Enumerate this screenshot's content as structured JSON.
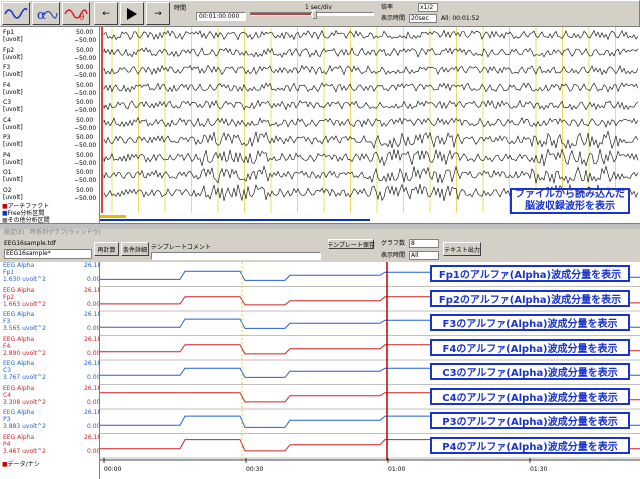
{
  "toolbar": {
    "time_label": "時間",
    "time_value": "00:01:00.000",
    "scale_label": "1 sec/div",
    "rate_label": "倍率",
    "rate_value": "x1/2",
    "display_time_label": "表示時間",
    "display_time_value": "20sec",
    "all_label": "All: 00:01:52"
  },
  "eeg": {
    "channels": [
      {
        "name": "Fp1",
        "unit": "[uvolt]",
        "max": "50.00",
        "min": "−50.00"
      },
      {
        "name": "Fp2",
        "unit": "[uvolt]",
        "max": "50.00",
        "min": "−50.00"
      },
      {
        "name": "F3",
        "unit": "[uvolt]",
        "max": "50.00",
        "min": "−50.00"
      },
      {
        "name": "F4",
        "unit": "[uvolt]",
        "max": "50.00",
        "min": "−50.00"
      },
      {
        "name": "C3",
        "unit": "[uvolt]",
        "max": "50.00",
        "min": "−50.00"
      },
      {
        "name": "C4",
        "unit": "[uvolt]",
        "max": "50.00",
        "min": "−50.00"
      },
      {
        "name": "P3",
        "unit": "[uvolt]",
        "max": "50.00",
        "min": "−50.00"
      },
      {
        "name": "P4",
        "unit": "[uvolt]",
        "max": "50.00",
        "min": "−50.00"
      },
      {
        "name": "O1",
        "unit": "[uvolt]",
        "max": "50.00",
        "min": "−50.00"
      },
      {
        "name": "O2",
        "unit": "[uvolt]",
        "max": "50.00",
        "min": "−50.00"
      }
    ],
    "legend": [
      "アーチファクト",
      "Free分析区間",
      "その他分析区間"
    ],
    "legend_colors": [
      "#d00000",
      "#1030c0",
      "#808080"
    ],
    "callout_line1": "ファイルから読み込んだ",
    "callout_line2": "脳波収録波形を表示"
  },
  "tabs": [
    "設定(E)",
    "時系列グラフ(ウィンドウ)"
  ],
  "analysis": {
    "file_label": "EEG16sample.tdf",
    "file_select": "EEG16sample*",
    "buttons": [
      "再計算",
      "条件詳細",
      "テンプレートコメント"
    ],
    "template_save": "テンプレート保存",
    "graph_count_label": "グラフ数",
    "graph_count": "8",
    "display_time_label": "表示時間",
    "display_time_value": "All",
    "text_output": "テキスト出力",
    "rows": [
      {
        "title": "EEG Alpha",
        "ch": "Fp1",
        "max": "26.18",
        "value": "1.630 uvolt^2",
        "zero": "0.00",
        "color": "#2060d0",
        "callout": "Fp1のアルファ(Alpha)波成分量を表示",
        "levels": [
          0.25,
          0.25,
          0.65,
          0.65,
          0.2,
          0.2,
          0.45,
          0.45,
          0.6,
          0.6,
          0.2,
          0.2,
          0.35,
          0.35
        ]
      },
      {
        "title": "EEG Alpha",
        "ch": "Fp2",
        "max": "26.18",
        "value": "1.663 uvolt^2",
        "zero": "0.00",
        "color": "#d02020",
        "callout": "Fp2のアルファ(Alpha)波成分量を表示",
        "levels": [
          0.25,
          0.25,
          0.6,
          0.6,
          0.2,
          0.2,
          0.4,
          0.4,
          0.6,
          0.6,
          0.2,
          0.2,
          0.3,
          0.3
        ]
      },
      {
        "title": "EEG Alpha",
        "ch": "F3",
        "max": "26.18",
        "value": "3.565 uvolt^2",
        "zero": "0.00",
        "color": "#2060d0",
        "callout": "F3のアルファ(Alpha)波成分量を表示",
        "levels": [
          0.3,
          0.3,
          0.7,
          0.7,
          0.25,
          0.25,
          0.5,
          0.5,
          0.65,
          0.65,
          0.25,
          0.25,
          0.3,
          0.3
        ]
      },
      {
        "title": "EEG Alpha",
        "ch": "F4",
        "max": "26.18",
        "value": "2.890 uvolt^2",
        "zero": "0.00",
        "color": "#d02020",
        "callout": "F4のアルファ(Alpha)波成分量を表示",
        "levels": [
          0.3,
          0.3,
          0.65,
          0.65,
          0.2,
          0.2,
          0.45,
          0.45,
          0.65,
          0.65,
          0.25,
          0.25,
          0.35,
          0.35
        ]
      },
      {
        "title": "EEG Alpha",
        "ch": "C3",
        "max": "26.18",
        "value": "3.767 uvolt^2",
        "zero": "0.00",
        "color": "#2060d0",
        "callout": "C3のアルファ(Alpha)波成分量を表示",
        "levels": [
          0.35,
          0.35,
          0.7,
          0.7,
          0.25,
          0.25,
          0.55,
          0.55,
          0.7,
          0.7,
          0.3,
          0.3,
          0.35,
          0.35
        ]
      },
      {
        "title": "EEG Alpha",
        "ch": "C4",
        "max": "26.18",
        "value": "3.308 uvolt^2",
        "zero": "0.00",
        "color": "#d02020",
        "callout": "C4のアルファ(Alpha)波成分量を表示",
        "levels": [
          0.7,
          0.7,
          0.7,
          0.7,
          0.25,
          0.25,
          0.55,
          0.55,
          0.7,
          0.7,
          0.3,
          0.3,
          0.35,
          0.35
        ]
      },
      {
        "title": "EEG Alpha",
        "ch": "P3",
        "max": "26.18",
        "value": "3.883 uvolt^2",
        "zero": "0.00",
        "color": "#2060d0",
        "callout": "P3のアルファ(Alpha)波成分量を表示",
        "levels": [
          0.3,
          0.3,
          0.75,
          0.75,
          0.2,
          0.2,
          0.55,
          0.55,
          0.75,
          0.75,
          0.25,
          0.25,
          0.3,
          0.3
        ]
      },
      {
        "title": "EEG Alpha",
        "ch": "P4",
        "max": "26.18",
        "value": "3.467 uvolt^2",
        "zero": "0.00",
        "color": "#d02020",
        "callout": "P4のアルファ(Alpha)波成分量を表示",
        "levels": [
          0.35,
          0.35,
          0.8,
          0.8,
          0.25,
          0.25,
          0.55,
          0.55,
          0.8,
          0.8,
          0.3,
          0.3,
          0.35,
          0.35
        ]
      }
    ],
    "legend": "データ/ナシ",
    "time_ticks": [
      "00:00",
      "00:30",
      "01:00",
      "01:30"
    ]
  }
}
